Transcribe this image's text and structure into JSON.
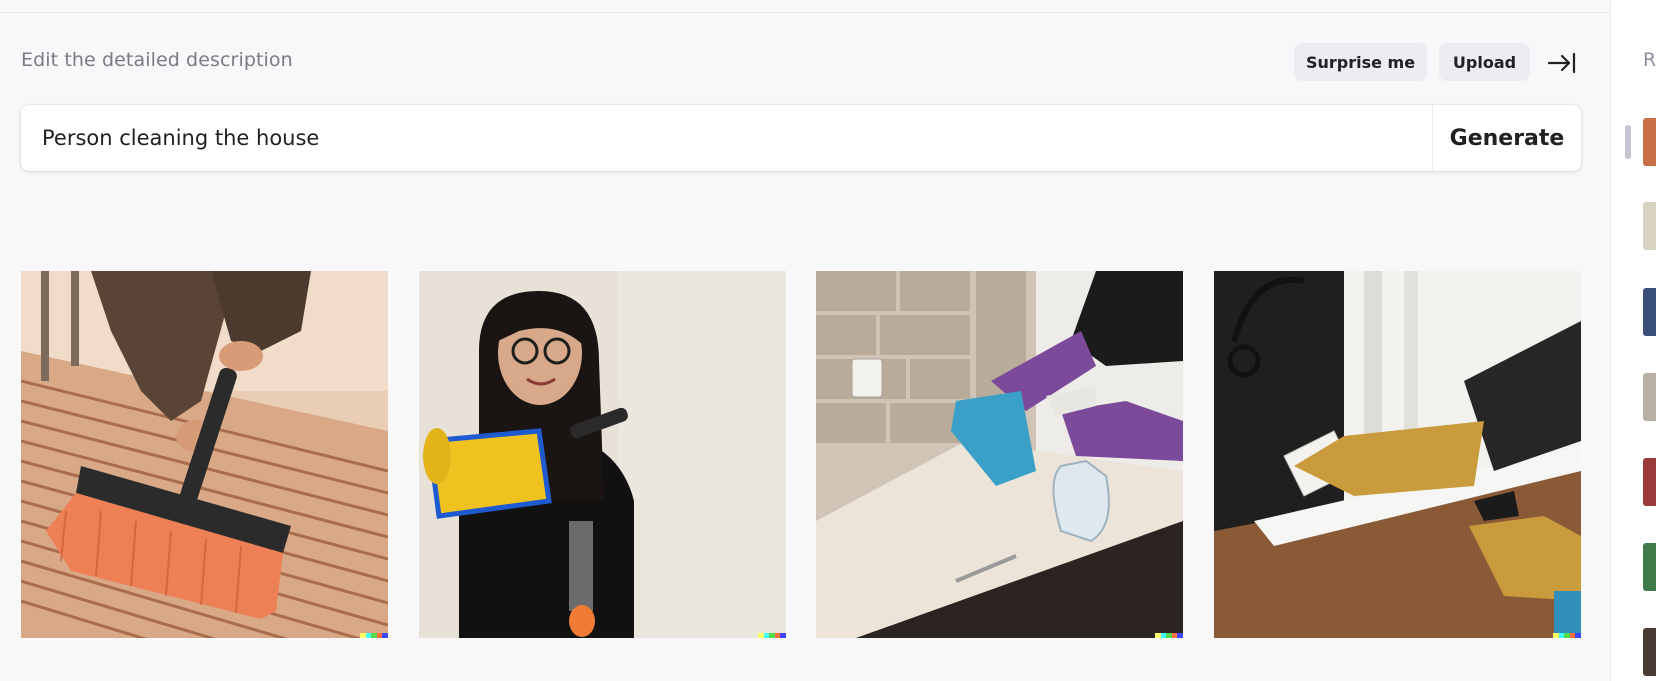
{
  "header": {
    "description_label": "Edit the detailed description",
    "surprise_label": "Surprise me",
    "upload_label": "Upload"
  },
  "prompt": {
    "value": "Person cleaning the house",
    "generate_label": "Generate"
  },
  "results": [
    {
      "subject": "orange brush scrubbing tiled steps"
    },
    {
      "subject": "woman holding yellow cleaning tool"
    },
    {
      "subject": "gloved hands wiping kitchen counter with spray bottle"
    },
    {
      "subject": "gloved hand wiping door with cloth"
    }
  ],
  "sidebar": {
    "header_letter": "R"
  },
  "colors": {
    "background": "#f8f8fa",
    "pill": "#ececf1",
    "text": "#202123",
    "muted": "#7a7a80"
  },
  "icons": {
    "collapse": "arrow-right-to-bar-icon"
  }
}
